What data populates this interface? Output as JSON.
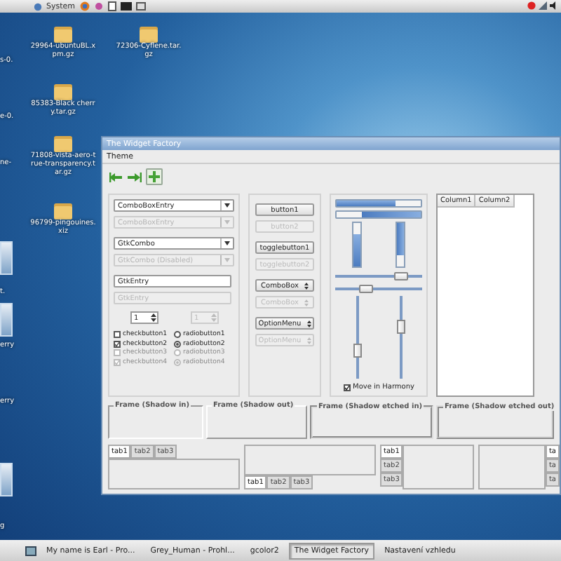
{
  "top_panel": {
    "menus": [
      "System"
    ]
  },
  "desktop_icons": [
    {
      "label": "29964-ubuntuBL.xpm.gz",
      "kind": "folder"
    },
    {
      "label": "72306-Cyflene.tar.gz",
      "kind": "folder"
    },
    {
      "label": "85383-Black cherry.tar.gz",
      "kind": "folder"
    },
    {
      "label": "71808-vista-aero-true-transparency.tar.gz",
      "kind": "folder"
    },
    {
      "label": "96799-pingouines.xiz",
      "kind": "folder"
    },
    {
      "label": "s-0.",
      "kind": "cut"
    },
    {
      "label": "e-0.",
      "kind": "cut"
    },
    {
      "label": "ne-",
      "kind": "cut"
    },
    {
      "label": "t.",
      "kind": "cut"
    },
    {
      "label": "erry",
      "kind": "cut"
    },
    {
      "label": "erry",
      "kind": "cut"
    },
    {
      "label": "g",
      "kind": "cut"
    }
  ],
  "window": {
    "title": "The Widget Factory",
    "menu": [
      "Theme"
    ],
    "entries": [
      {
        "kind": "combo_entry",
        "text": "ComboBoxEntry",
        "disabled": false
      },
      {
        "kind": "combo_entry",
        "text": "ComboBoxEntry",
        "disabled": true
      },
      {
        "kind": "combo",
        "text": "GtkCombo",
        "disabled": false
      },
      {
        "kind": "combo",
        "text": "GtkCombo (Disabled)",
        "disabled": true
      },
      {
        "kind": "entry",
        "text": "GtkEntry",
        "disabled": false
      },
      {
        "kind": "entry",
        "text": "GtkEntry",
        "disabled": true
      }
    ],
    "spin_buttons": [
      {
        "value": "1",
        "disabled": false
      },
      {
        "value": "1",
        "disabled": true
      }
    ],
    "toggles": [
      {
        "kind": "check",
        "label": "checkbutton1",
        "checked": false,
        "disabled": false
      },
      {
        "kind": "radio",
        "label": "radiobutton1",
        "checked": false,
        "disabled": false
      },
      {
        "kind": "check",
        "label": "checkbutton2",
        "checked": true,
        "disabled": false
      },
      {
        "kind": "radio",
        "label": "radiobutton2",
        "checked": true,
        "disabled": false
      },
      {
        "kind": "check",
        "label": "checkbutton3",
        "checked": false,
        "disabled": true
      },
      {
        "kind": "radio",
        "label": "radiobutton3",
        "checked": false,
        "disabled": true
      },
      {
        "kind": "check",
        "label": "checkbutton4",
        "checked": true,
        "disabled": true
      },
      {
        "kind": "radio",
        "label": "radiobutton4",
        "checked": true,
        "disabled": true
      }
    ],
    "buttons": [
      {
        "kind": "button",
        "label": "button1",
        "disabled": false
      },
      {
        "kind": "button",
        "label": "button2",
        "disabled": true
      },
      {
        "kind": "toggle",
        "label": "togglebutton1",
        "disabled": false
      },
      {
        "kind": "toggle",
        "label": "togglebutton2",
        "disabled": true
      },
      {
        "kind": "combo",
        "label": "ComboBox",
        "disabled": false
      },
      {
        "kind": "combo",
        "label": "ComboBox",
        "disabled": true
      },
      {
        "kind": "option",
        "label": "OptionMenu",
        "disabled": false
      },
      {
        "kind": "option",
        "label": "OptionMenu",
        "disabled": true
      }
    ],
    "progress_bars": [
      {
        "kind": "horizontal",
        "inverted": false,
        "level": 0.7
      },
      {
        "kind": "horizontal",
        "inverted": true,
        "level": 0.7
      },
      {
        "kind": "vertical",
        "inverted": false,
        "level": 0.75
      },
      {
        "kind": "vertical",
        "inverted": true,
        "level": 0.75
      }
    ],
    "scales": [
      {
        "kind": "horizontal",
        "level": 0.75
      },
      {
        "kind": "horizontal",
        "level": 0.35
      },
      {
        "kind": "vertical",
        "level": 0.7
      },
      {
        "kind": "vertical",
        "level": 0.35
      }
    ],
    "harmony": {
      "label": "Move in Harmony",
      "checked": true
    },
    "tree_columns": [
      "Column1",
      "Column2"
    ],
    "frames": [
      {
        "label": "Frame (Shadow in)",
        "kind": "in"
      },
      {
        "label": "Frame (Shadow out)",
        "kind": "out"
      },
      {
        "label": "Frame (Shadow etched in)",
        "kind": "etched_in"
      },
      {
        "label": "Frame (Shadow etched out)",
        "kind": "etched_out"
      }
    ],
    "notebooks": [
      {
        "kind": "top",
        "tabs": [
          {
            "label": "tab1",
            "selected": true
          },
          {
            "label": "tab2",
            "selected": false
          },
          {
            "label": "tab3",
            "selected": false
          }
        ]
      },
      {
        "kind": "bottom",
        "tabs": [
          {
            "label": "tab1",
            "selected": true
          },
          {
            "label": "tab2",
            "selected": false
          },
          {
            "label": "tab3",
            "selected": false
          }
        ]
      },
      {
        "kind": "left",
        "tabs": [
          {
            "label": "tab1",
            "selected": true
          },
          {
            "label": "tab2",
            "selected": false
          },
          {
            "label": "tab3",
            "selected": false
          }
        ]
      },
      {
        "kind": "right",
        "tabs": [
          {
            "label": "ta",
            "selected": true
          },
          {
            "label": "ta",
            "selected": false
          },
          {
            "label": "ta",
            "selected": false
          }
        ]
      }
    ]
  },
  "taskbar": [
    {
      "label": "My name is Earl - Pro...",
      "selected": false
    },
    {
      "label": "Grey_Human - Prohl...",
      "selected": false
    },
    {
      "label": "gcolor2",
      "selected": false
    },
    {
      "label": "The Widget Factory",
      "selected": true
    },
    {
      "label": "Nastavení vzhledu",
      "selected": false
    }
  ]
}
